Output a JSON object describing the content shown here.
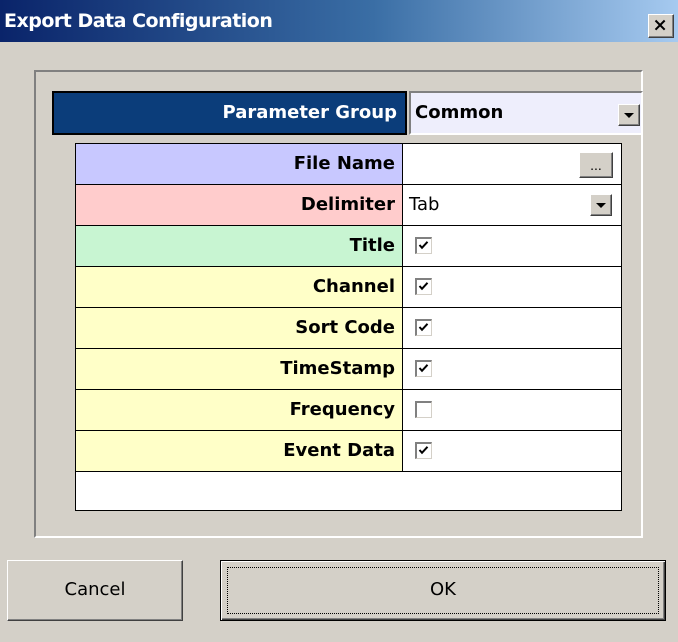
{
  "window": {
    "title": "Export Data Configuration",
    "close_icon": "close-icon"
  },
  "parameter_group": {
    "label": "Parameter Group",
    "value": "Common",
    "bg": "#0b3d7a",
    "field_bg": "#eeeefc"
  },
  "rows": [
    {
      "label": "File Name",
      "type": "file",
      "value": "",
      "browse_label": "...",
      "bg": "#c8c8ff"
    },
    {
      "label": "Delimiter",
      "type": "select",
      "value": "Tab",
      "bg": "#ffcccc"
    },
    {
      "label": "Title",
      "type": "checkbox",
      "checked": true,
      "bg": "#c8f5d2"
    },
    {
      "label": "Channel",
      "type": "checkbox",
      "checked": true,
      "bg": "#ffffc8"
    },
    {
      "label": "Sort Code",
      "type": "checkbox",
      "checked": true,
      "bg": "#ffffc8"
    },
    {
      "label": "TimeStamp",
      "type": "checkbox",
      "checked": true,
      "bg": "#ffffc8"
    },
    {
      "label": "Frequency",
      "type": "checkbox",
      "checked": false,
      "bg": "#ffffc8"
    },
    {
      "label": "Event Data",
      "type": "checkbox",
      "checked": true,
      "bg": "#ffffc8"
    }
  ],
  "buttons": {
    "cancel": "Cancel",
    "ok": "OK"
  }
}
